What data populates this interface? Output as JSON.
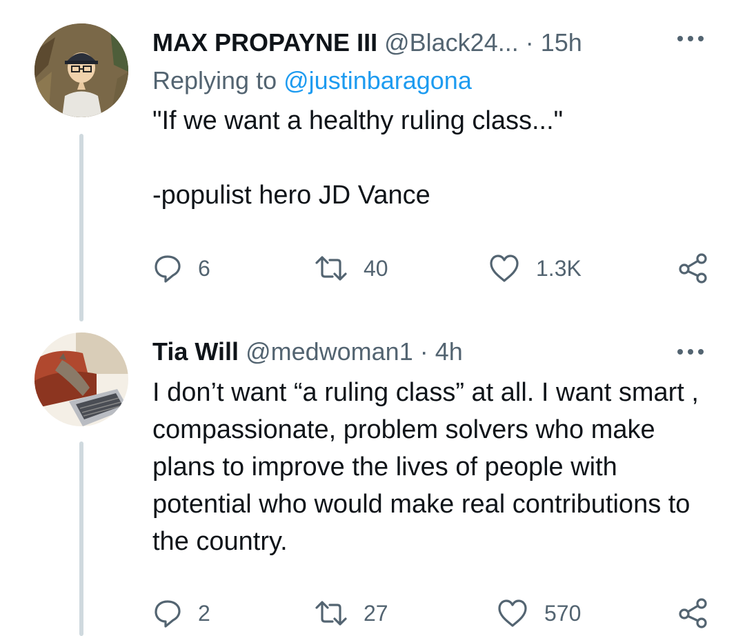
{
  "tweets": [
    {
      "display_name": "MAX PROPAYNE III",
      "handle": "@Black24...",
      "separator": "·",
      "time": "15h",
      "replying_prefix": "Replying to",
      "replying_mention": "@justinbaragona",
      "text": "\"If we want a healthy ruling class...\"\n\n-populist hero JD Vance",
      "replies": "6",
      "retweets": "40",
      "likes": "1.3K"
    },
    {
      "display_name": "Tia Will",
      "handle": "@medwoman1",
      "separator": "·",
      "time": "4h",
      "text": "I don’t want “a ruling class” at all. I want smart , compassionate, problem solvers who make plans to improve the lives of people with potential who would make real contributions to the country.",
      "replies": "2",
      "retweets": "27",
      "likes": "570"
    }
  ],
  "icons": {
    "reply": "reply-icon",
    "retweet": "retweet-icon",
    "like": "heart-icon",
    "share": "share-icon",
    "more": "more-options-icon"
  },
  "colors": {
    "text": "#0f1419",
    "secondary": "#536471",
    "link": "#1d9bf0",
    "thread_line": "#cfd9de"
  }
}
